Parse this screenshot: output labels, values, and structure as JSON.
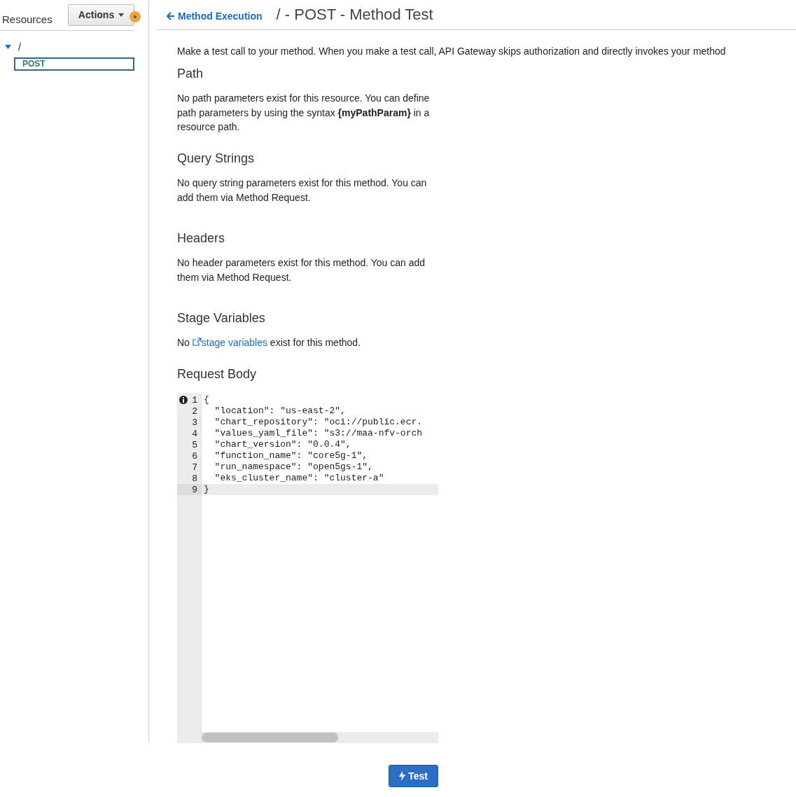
{
  "sidebar": {
    "title": "Resources",
    "actions_button": "Actions",
    "tree": [
      {
        "label": "/",
        "expanded": true,
        "selected": false,
        "children": [
          {
            "label": "POST",
            "selected": true
          }
        ]
      }
    ]
  },
  "header": {
    "back_link": "Method Execution",
    "title": "/ - POST - Method Test"
  },
  "intro": "Make a test call to your method. When you make a test call, API Gateway skips authorization and directly invokes your method",
  "sections": [
    {
      "heading": "Path",
      "kind": "text",
      "text": "No path parameters exist for this resource. You can define path parameters by using the syntax **{myPathParam}** in a resource path."
    },
    {
      "heading": "Query Strings",
      "kind": "text",
      "text": "No query string parameters exist for this method. You can add them via Method Request."
    },
    {
      "heading": "Headers",
      "kind": "text",
      "text": "No header parameters exist for this method. You can add them via Method Request."
    },
    {
      "heading": "Stage Variables",
      "kind": "link",
      "before": "No",
      "link": "stage variables",
      "after": "exist for this method."
    }
  ],
  "request_body": {
    "heading": "Request Body",
    "lines": [
      {
        "number": "1",
        "code": "{",
        "info": true,
        "current": false
      },
      {
        "number": "2",
        "code": "  \"location\": \"us-east-2\",",
        "info": false,
        "current": false
      },
      {
        "number": "3",
        "code": "  \"chart_repository\": \"oci://public.ecr.",
        "info": false,
        "current": false
      },
      {
        "number": "4",
        "code": "  \"values_yaml_file\": \"s3://maa-nfv-orch",
        "info": false,
        "current": false
      },
      {
        "number": "5",
        "code": "  \"chart_version\": \"0.0.4\",",
        "info": false,
        "current": false
      },
      {
        "number": "6",
        "code": "  \"function_name\": \"core5g-1\",",
        "info": false,
        "current": false
      },
      {
        "number": "7",
        "code": "  \"run_namespace\": \"open5gs-1\",",
        "info": false,
        "current": false
      },
      {
        "number": "8",
        "code": "  \"eks_cluster_name\": \"cluster-a\"",
        "info": false,
        "current": false
      },
      {
        "number": "9",
        "code": "}",
        "info": false,
        "current": true
      }
    ]
  },
  "test_button": "Test"
}
